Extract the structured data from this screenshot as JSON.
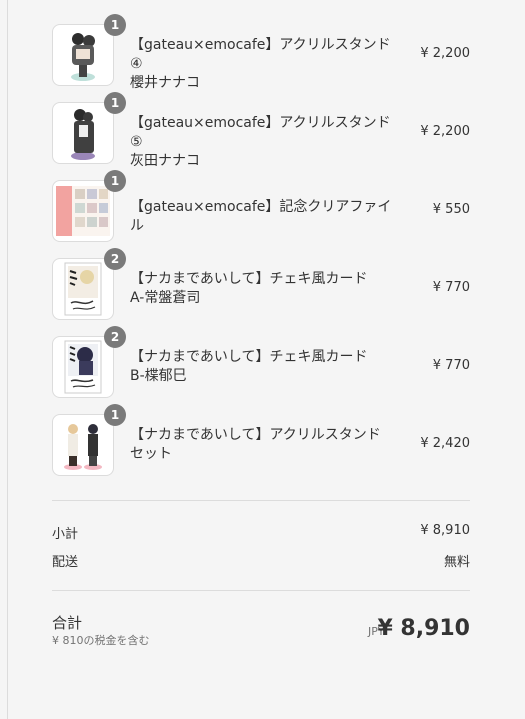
{
  "items": [
    {
      "qty": "1",
      "name_line1": "【gateau×emocafe】アクリルスタンド④",
      "name_line2": "櫻井ナナコ",
      "price": "¥ 2,200",
      "thumb": "acrylic-stand-pink"
    },
    {
      "qty": "1",
      "name_line1": "【gateau×emocafe】アクリルスタンド⑤",
      "name_line2": "灰田ナナコ",
      "price": "¥ 2,200",
      "thumb": "acrylic-stand-purple"
    },
    {
      "qty": "1",
      "name_line1": "【gateau×emocafe】記念クリアファイル",
      "name_line2": "",
      "price": "¥ 550",
      "thumb": "clear-file"
    },
    {
      "qty": "2",
      "name_line1": "【ナカまであいして】チェキ風カード",
      "name_line2": "A-常盤蒼司",
      "price": "¥ 770",
      "thumb": "cheki-card-a"
    },
    {
      "qty": "2",
      "name_line1": "【ナカまであいして】チェキ風カード",
      "name_line2": "B-楪郁巳",
      "price": "¥ 770",
      "thumb": "cheki-card-b"
    },
    {
      "qty": "1",
      "name_line1": "【ナカまであいして】アクリルスタンド",
      "name_line2": "セット",
      "price": "¥ 2,420",
      "thumb": "acrylic-stand-set"
    }
  ],
  "summary": {
    "subtotal_label": "小計",
    "subtotal_value": "¥ 8,910",
    "shipping_label": "配送",
    "shipping_value": "無料",
    "total_label": "合計",
    "tax_note": "¥ 810の税金を含む",
    "currency": "JPY",
    "total_value": "¥ 8,910"
  }
}
